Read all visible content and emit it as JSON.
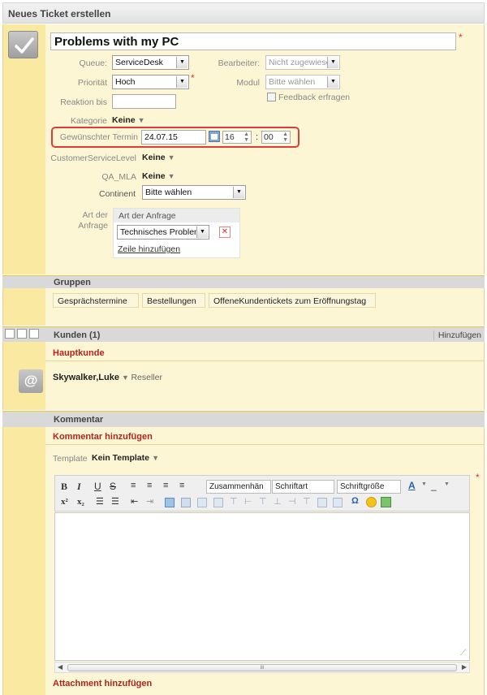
{
  "window": {
    "title": "Neues Ticket erstellen"
  },
  "ticket": {
    "title": "Problems with my PC",
    "queue_label": "Queue:",
    "queue_value": "ServiceDesk",
    "bearbeiter_label": "Bearbeiter:",
    "bearbeiter_value": "Nicht zugewiese",
    "prioritaet_label": "Priorität",
    "prioritaet_value": "Hoch",
    "modul_label": "Modul",
    "modul_value": "Bitte wählen",
    "feedback_label": "Feedback erfragen",
    "reaktion_label": "Reaktion bis",
    "kategorie_label": "Kategorie",
    "kategorie_value": "Keine",
    "termin_label": "Gewünschter Termin",
    "termin_date": "24.07.15",
    "termin_hour": "16",
    "termin_sep": ":",
    "termin_min": "00",
    "csl_label": "CustomerServiceLevel",
    "csl_value": "Keine",
    "qa_label": "QA_MLA",
    "qa_value": "Keine",
    "continent_label": "Continent",
    "continent_value": "Bitte wählen",
    "art_label_1": "Art der",
    "art_label_2": "Anfrage",
    "art_header": "Art der Anfrage",
    "art_value": "Technisches Problem",
    "add_row": "Zeile hinzufügen"
  },
  "gruppen": {
    "title": "Gruppen",
    "items": [
      "Gesprächstermine",
      "Bestellungen",
      "OffeneKundentickets zum Eröffnungstag"
    ]
  },
  "kunden": {
    "title": "Kunden (1)",
    "add_label": "Hinzufügen",
    "main_label": "Hauptkunde",
    "customer_name": "Skywalker,Luke",
    "customer_role": "Reseller"
  },
  "kommentar": {
    "title": "Kommentar",
    "add_label": "Kommentar hinzufügen",
    "template_label": "Template",
    "template_value": "Kein Template",
    "toolbar": {
      "bold": "B",
      "italic": "I",
      "underline": "U",
      "strike": "S",
      "paragraph_select": "Zusammenhän",
      "font_select": "Schriftart",
      "size_select": "Schriftgröße",
      "superscript": "x²",
      "subscript": "x₂",
      "omega": "Ω"
    },
    "scroll_mid": "III",
    "attachment_label": "Attachment hinzufügen"
  },
  "colors": {
    "panel": "#fdf6d4",
    "gutter": "#fae9a0",
    "section_border": "#f0c63c",
    "accent_red": "#b3231d",
    "highlight_box": "#e23a3a"
  }
}
